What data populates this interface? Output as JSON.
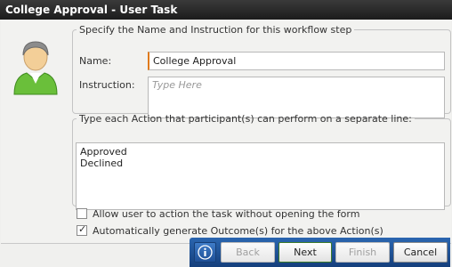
{
  "window": {
    "title": "College Approval - User Task"
  },
  "step_group": {
    "legend": "Specify the Name and Instruction for this workflow step",
    "name_label": "Name:",
    "name_value": "College Approval",
    "instruction_label": "Instruction:",
    "instruction_placeholder": "Type Here"
  },
  "actions_group": {
    "legend": "Type each Action that participant(s) can perform on a separate line:",
    "actions_text": "Approved\nDeclined"
  },
  "options": [
    {
      "label": "Allow user to action the task without opening the form",
      "checked": false
    },
    {
      "label": "Automatically generate Outcome(s) for the above Action(s)",
      "checked": true
    }
  ],
  "buttons": {
    "info_icon": "info-icon",
    "back": "Back",
    "next": "Next",
    "finish": "Finish",
    "cancel": "Cancel"
  },
  "colors": {
    "titlebar": "#1c1c1c",
    "button_bar": "#1f5299",
    "name_accent": "#e07a1a",
    "avatar_shirt": "#6abf3a"
  }
}
